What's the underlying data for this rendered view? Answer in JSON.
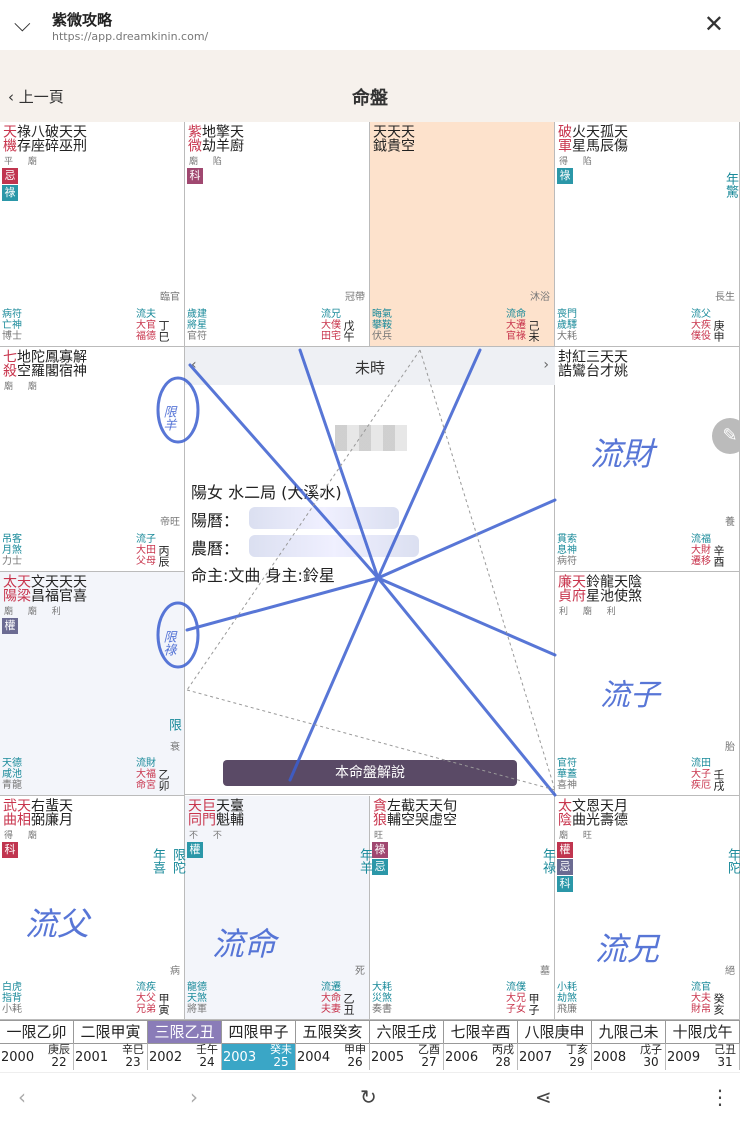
{
  "browser": {
    "title": "紫微攻略",
    "url": "https://app.dreamkinin.com/"
  },
  "header": {
    "back_label": "上一頁",
    "title": "命盤"
  },
  "center": {
    "time": "未時",
    "line1": "陽女 水二局 (大溪水)",
    "solar_label": "陽曆：",
    "lunar_label": "農曆：",
    "master": "命主:文曲 身主:鈴星",
    "button": "本命盤解說"
  },
  "handwriting": {
    "a": "流財",
    "b": "流子",
    "c": "流父",
    "d": "流命",
    "e": "流兄",
    "limit_yang": "限羊",
    "limit_lu": "限祿"
  },
  "palaces": [
    {
      "stars": [
        [
          "天機",
          "mj"
        ],
        [
          "祿存",
          "mn"
        ],
        [
          "八座",
          "mn"
        ],
        [
          "破碎",
          "mn"
        ],
        [
          "天巫",
          "mn"
        ],
        [
          "天刑",
          "mn"
        ]
      ],
      "bright": "平 廟",
      "badges": [
        [
          "忌",
          "b-ji"
        ],
        [
          "祿",
          "b-lu"
        ]
      ],
      "bl": [
        "病符",
        "亡神",
        "博士"
      ],
      "br_gods": [
        "流夫",
        "大官"
      ],
      "br_palace": "福德",
      "br_gz": "丁巳",
      "stage": "臨官"
    },
    {
      "stars": [
        [
          "紫微",
          "mj"
        ],
        [
          "地劫",
          "mn"
        ],
        [
          "擎羊",
          "mn"
        ],
        [
          "天廚",
          "mn"
        ]
      ],
      "bright": "廟 陷",
      "badges": [
        [
          "科",
          "b-ke"
        ]
      ],
      "bl": [
        "歲建",
        "將星",
        "官符"
      ],
      "br_gods": [
        "流兄",
        "大僕"
      ],
      "br_palace": "田宅",
      "br_gz": "戊午",
      "stage": "冠帶"
    },
    {
      "stars": [
        [
          "天鉞",
          "mn"
        ],
        [
          "天貴",
          "mn"
        ],
        [
          "天空",
          "mn"
        ]
      ],
      "bright": "",
      "badges": [],
      "bl": [
        "晦氣",
        "攀鞍",
        "伏兵"
      ],
      "br_gods": [
        "流命",
        "大遷"
      ],
      "br_palace": "官祿",
      "br_gz": "己未",
      "stage": "沐浴"
    },
    {
      "stars": [
        [
          "破軍",
          "mj"
        ],
        [
          "火星",
          "mn"
        ],
        [
          "天馬",
          "mn"
        ],
        [
          "孤辰",
          "mn"
        ],
        [
          "天傷",
          "mn"
        ]
      ],
      "bright": "得 陷",
      "badges": [
        [
          "祿",
          "b-lu"
        ]
      ],
      "bl": [
        "喪門",
        "歲驛",
        "大耗"
      ],
      "br_gods": [
        "流父",
        "大疾"
      ],
      "br_palace": "僕役",
      "br_gz": "庚申",
      "stage": "長生"
    },
    {
      "stars": [
        [
          "七殺",
          "mj"
        ],
        [
          "地空",
          "mn"
        ],
        [
          "陀羅",
          "mn"
        ],
        [
          "鳳閣",
          "mn"
        ],
        [
          "寡宿",
          "mn"
        ],
        [
          "解神",
          "mn"
        ]
      ],
      "bright": "廟 廟",
      "badges": [],
      "bl": [
        "吊客",
        "月煞",
        "力士"
      ],
      "br_gods": [
        "流子",
        "大田"
      ],
      "br_palace": "父母",
      "br_gz": "丙辰",
      "stage": "帝旺"
    },
    {
      "stars": [
        [
          "封誥",
          "mn"
        ],
        [
          "紅鸞",
          "mn"
        ],
        [
          "三台",
          "mn"
        ],
        [
          "天才",
          "mn"
        ],
        [
          "天姚",
          "mn"
        ]
      ],
      "bright": "",
      "badges": [],
      "bl": [
        "貫索",
        "息神",
        "病符"
      ],
      "br_gods": [
        "流福",
        "大財"
      ],
      "br_palace": "遷移",
      "br_gz": "辛酉",
      "stage": "養"
    },
    {
      "stars": [
        [
          "太陽",
          "mj"
        ],
        [
          "天梁",
          "mj"
        ],
        [
          "文昌",
          "mn"
        ],
        [
          "天福",
          "mn"
        ],
        [
          "天官",
          "mn"
        ],
        [
          "天喜",
          "mn"
        ]
      ],
      "bright": "廟 廟 利",
      "badges": [
        [
          "權",
          "b-quan"
        ]
      ],
      "bl": [
        "天德",
        "咸池",
        "青龍"
      ],
      "br_gods": [
        "流財",
        "大福"
      ],
      "br_palace": "命宮",
      "br_gz": "乙卯",
      "stage": "衰"
    },
    {
      "stars": [
        [
          "廉貞",
          "mj"
        ],
        [
          "天府",
          "mj"
        ],
        [
          "鈴星",
          "mn"
        ],
        [
          "龍池",
          "mn"
        ],
        [
          "天使",
          "mn"
        ],
        [
          "陰煞",
          "mn"
        ]
      ],
      "bright": "利 廟 利",
      "badges": [],
      "bl": [
        "官符",
        "華蓋",
        "喜神"
      ],
      "br_gods": [
        "流田",
        "大子"
      ],
      "br_palace": "疾厄",
      "br_gz": "壬戌",
      "stage": "胎"
    },
    {
      "stars": [
        [
          "武曲",
          "mj"
        ],
        [
          "天相",
          "mj"
        ],
        [
          "右弼",
          "mn"
        ],
        [
          "蜚廉",
          "mn"
        ],
        [
          "天月",
          "mn"
        ]
      ],
      "bright": "得 廟",
      "badges": [
        [
          "科",
          "b-ji"
        ]
      ],
      "bl": [
        "白虎",
        "指背",
        "小耗"
      ],
      "br_gods": [
        "流疾",
        "大父"
      ],
      "br_palace": "兄弟",
      "br_gz": "甲寅",
      "stage": "病"
    },
    {
      "stars": [
        [
          "天同",
          "mj"
        ],
        [
          "巨門",
          "mj"
        ],
        [
          "天魁",
          "mn"
        ],
        [
          "臺輔",
          "mn"
        ]
      ],
      "bright": "不 不",
      "badges": [
        [
          "權",
          "b-lu"
        ]
      ],
      "bl": [
        "龍德",
        "天煞",
        "將軍"
      ],
      "br_gods": [
        "流遷",
        "大命"
      ],
      "br_palace": "夫妻",
      "br_gz": "乙丑",
      "stage": "死"
    },
    {
      "stars": [
        [
          "貪狼",
          "mj"
        ],
        [
          "左輔",
          "mn"
        ],
        [
          "截空",
          "mn"
        ],
        [
          "天哭",
          "mn"
        ],
        [
          "天虛",
          "mn"
        ],
        [
          "旬空",
          "mn"
        ]
      ],
      "bright": "旺",
      "badges": [
        [
          "祿",
          "b-ke"
        ],
        [
          "忌",
          "b-lu"
        ]
      ],
      "bl": [
        "大耗",
        "災煞",
        "奏書"
      ],
      "br_gods": [
        "流僕",
        "大兄"
      ],
      "br_palace": "子女",
      "br_gz": "甲子",
      "stage": "墓"
    },
    {
      "stars": [
        [
          "太陰",
          "mj"
        ],
        [
          "文曲",
          "mn"
        ],
        [
          "恩光",
          "mn"
        ],
        [
          "天壽",
          "mn"
        ],
        [
          "月德",
          "mn"
        ]
      ],
      "bright": "廟 旺",
      "badges": [
        [
          "權",
          "b-ji"
        ],
        [
          "忌",
          "b-quan"
        ],
        [
          "科",
          "b-lu"
        ]
      ],
      "bl": [
        "小耗",
        "劫煞",
        "飛廉"
      ],
      "br_gods": [
        "流官",
        "大夫"
      ],
      "br_palace": "財帛",
      "br_gz": "癸亥",
      "stage": "絕"
    }
  ],
  "notes": {
    "p3": "年驚",
    "p8a": "年喜",
    "p8b": "限陀",
    "p9": "年羊",
    "p10": "年祿",
    "p11": "年陀",
    "p6": "限"
  },
  "limits": {
    "top": [
      "一限乙卯",
      "二限甲寅",
      "三限乙丑",
      "四限甲子",
      "五限癸亥",
      "六限壬戌",
      "七限辛酉",
      "八限庚申",
      "九限己未",
      "十限戊午"
    ],
    "years": [
      "2000",
      "2001",
      "2002",
      "2003",
      "2004",
      "2005",
      "2006",
      "2007",
      "2008",
      "2009"
    ],
    "gz": [
      "庚辰",
      "辛巳",
      "壬午",
      "癸未",
      "甲申",
      "乙酉",
      "丙戌",
      "丁亥",
      "戊子",
      "己丑"
    ],
    "age": [
      "22",
      "23",
      "24",
      "25",
      "26",
      "27",
      "28",
      "29",
      "30",
      "31"
    ]
  },
  "icons": {
    "back_nav": "chevron-left-icon",
    "forward_nav": "chevron-right-icon",
    "reload": "reload-icon",
    "share": "share-icon",
    "more": "more-icon"
  }
}
